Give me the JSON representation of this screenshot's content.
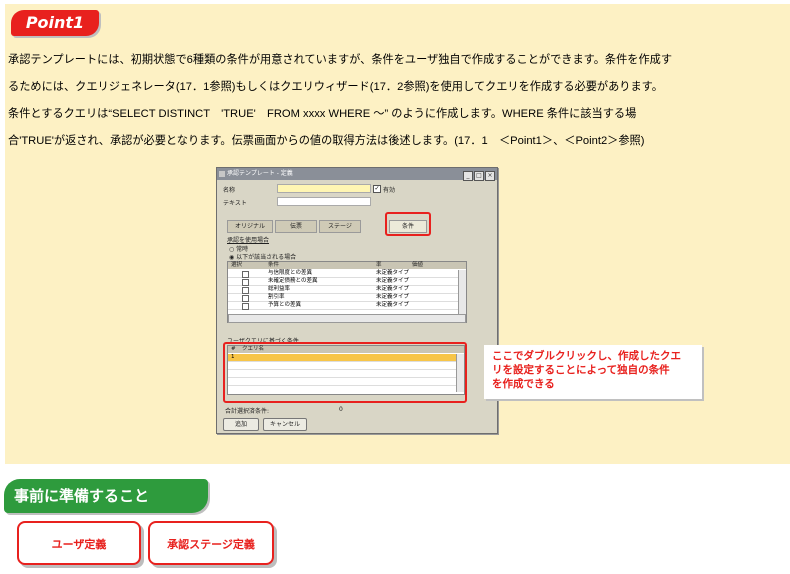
{
  "point_badge": "Point1",
  "paragraph": {
    "line1": "承認テンプレートには、初期状態で6種類の条件が用意されていますが、条件をユーザ独自で作成することができます。条件を作成す",
    "line2": "るためには、クエリジェネレータ(17．1参照)もしくはクエリウィザード(17．2参照)を使用してクエリを作成する必要があります。",
    "line3": "条件とするクエリは“SELECT DISTINCT　'TRUE'　FROM xxxx WHERE ～” のように作成します。WHERE 条件に該当する場",
    "line4": "合'TRUE'が返され、承認が必要となります。伝票画面からの値の取得方法は後述します。(17．1　＜Point1＞、＜Point2＞参照)"
  },
  "window": {
    "title": "承認テンプレート - 定義",
    "name_label": "名称",
    "active_label": "有効",
    "text_label": "テキスト",
    "tabs": [
      "オリジナル",
      "伝票",
      "ステージ",
      "条件"
    ],
    "usage_label": "承認を使用場合",
    "radio_always": "常時",
    "radio_when": "以下が該当される場合",
    "grid_headers": [
      "選択",
      "条件",
      "率",
      "価値"
    ],
    "grid_rows": [
      {
        "condition": "与信限度との差異",
        "ratio": "未定義タイプ"
      },
      {
        "condition": "未確定債務との差異",
        "ratio": "未定義タイプ"
      },
      {
        "condition": "総利益率",
        "ratio": "未定義タイプ"
      },
      {
        "condition": "割引率",
        "ratio": "未定義タイプ"
      },
      {
        "condition": "予算との差異",
        "ratio": "未定義タイプ"
      }
    ],
    "user_query_label": "ユーザクエリに基づく条件",
    "query_header_num": "#",
    "query_header_name": "クエリ名",
    "query_row_num": "1",
    "total_label": "合計選択済条件:",
    "total_value": "0",
    "add_button": "追加",
    "cancel_button": "キャンセル"
  },
  "callout_note": {
    "line1": "ここでダブルクリックし、作成したクエ",
    "line2": "リを設定することによって独自の条件",
    "line3": "を作成できる"
  },
  "prep_badge": "事前に準備すること",
  "prep_items": [
    "ユーザ定義",
    "承認ステージ定義"
  ],
  "colors": {
    "accent_red": "#e8211e",
    "accent_green": "#2e9b3d",
    "panel_bg": "#fdf1c4"
  }
}
